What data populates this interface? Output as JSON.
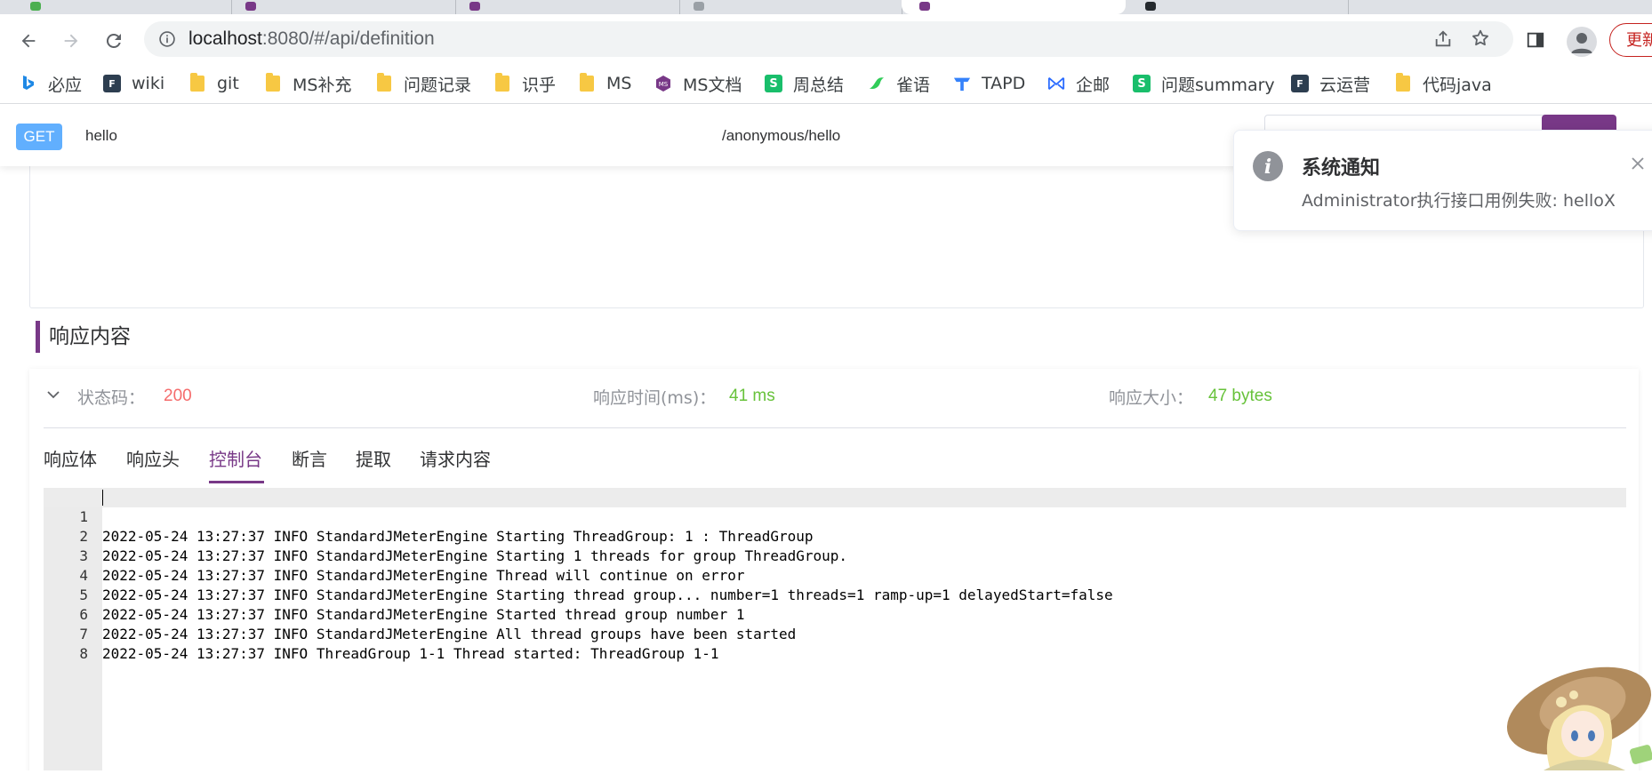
{
  "browser": {
    "address": {
      "host": "localhost",
      "rest": ":8080/#/api/definition"
    },
    "update_label": "更新",
    "bookmarks": [
      {
        "label": "必应",
        "icon": "bing-icon"
      },
      {
        "label": "wiki",
        "icon": "f2c-icon"
      },
      {
        "label": "git",
        "icon": "folder-icon"
      },
      {
        "label": "MS补充",
        "icon": "folder-icon"
      },
      {
        "label": "问题记录",
        "icon": "folder-icon"
      },
      {
        "label": "识乎",
        "icon": "folder-icon"
      },
      {
        "label": "MS",
        "icon": "folder-icon"
      },
      {
        "label": "MS文档",
        "icon": "ms-docs-icon"
      },
      {
        "label": "周总结",
        "icon": "s-doc-icon"
      },
      {
        "label": "雀语",
        "icon": "yuque-icon"
      },
      {
        "label": "TAPD",
        "icon": "tapd-icon"
      },
      {
        "label": "企邮",
        "icon": "mail-icon"
      },
      {
        "label": "问题summary",
        "icon": "s-doc-icon"
      },
      {
        "label": "云运营",
        "icon": "f2c-icon"
      },
      {
        "label": "代码java",
        "icon": "folder-icon"
      }
    ]
  },
  "api": {
    "method": "GET",
    "name": "hello",
    "path": "/anonymous/hello"
  },
  "response": {
    "section_title": "响应内容",
    "status_label": "状态码：",
    "status_value": "200",
    "time_label": "响应时间(ms)：",
    "time_value": "41 ms",
    "size_label": "响应大小：",
    "size_value": "47 bytes",
    "tabs": [
      "响应体",
      "响应头",
      "控制台",
      "断言",
      "提取",
      "请求内容"
    ],
    "active_tab": "控制台",
    "console_lines": [
      {
        "no": "1",
        "text": "2022-05-24 13:27:37 INFO StandardJMeterEngine Starting ThreadGroup: 1 : ThreadGroup"
      },
      {
        "no": "2",
        "text": "2022-05-24 13:27:37 INFO StandardJMeterEngine Starting 1 threads for group ThreadGroup."
      },
      {
        "no": "3",
        "text": "2022-05-24 13:27:37 INFO StandardJMeterEngine Thread will continue on error"
      },
      {
        "no": "4",
        "text": "2022-05-24 13:27:37 INFO StandardJMeterEngine Starting thread group... number=1 threads=1 ramp-up=1 delayedStart=false"
      },
      {
        "no": "5",
        "text": "2022-05-24 13:27:37 INFO StandardJMeterEngine Started thread group number 1"
      },
      {
        "no": "6",
        "text": "2022-05-24 13:27:37 INFO StandardJMeterEngine All thread groups have been started"
      },
      {
        "no": "7",
        "text": "2022-05-24 13:27:37 INFO ThreadGroup 1-1 Thread started: ThreadGroup 1-1"
      },
      {
        "no": "8",
        "text": ""
      }
    ]
  },
  "notification": {
    "title": "系统通知",
    "message": "Administrator执行接口用例失败: helloX"
  },
  "colors": {
    "accent": "#783887",
    "method_get": "#61affe",
    "status_error": "#f56c6c",
    "success": "#67c23a"
  }
}
